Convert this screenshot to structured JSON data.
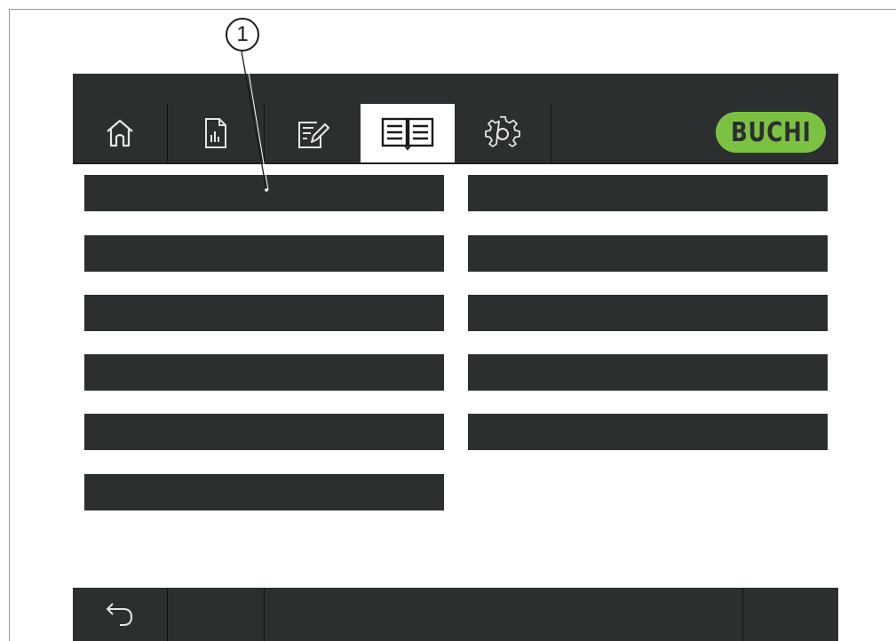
{
  "callout": {
    "number": "1"
  },
  "tabs": [
    {
      "name": "home",
      "icon": "home-icon",
      "active": false
    },
    {
      "name": "report",
      "icon": "report-icon",
      "active": false
    },
    {
      "name": "edit",
      "icon": "edit-icon",
      "active": false
    },
    {
      "name": "manual",
      "icon": "book-icon",
      "active": true
    },
    {
      "name": "settings",
      "icon": "gear-icon",
      "active": false
    }
  ],
  "logo": {
    "text": "BUCHI",
    "color": "#7cc242"
  },
  "menu_items": [
    {
      "label": ""
    },
    {
      "label": ""
    },
    {
      "label": ""
    },
    {
      "label": ""
    },
    {
      "label": ""
    },
    {
      "label": ""
    },
    {
      "label": ""
    },
    {
      "label": ""
    },
    {
      "label": ""
    },
    {
      "label": ""
    },
    {
      "label": ""
    }
  ],
  "bottom_bar": {
    "back_icon": "back-arrow-icon"
  },
  "colors": {
    "bar": "#2c2f30",
    "accent": "#7cc242",
    "active_tab": "#ffffff"
  }
}
